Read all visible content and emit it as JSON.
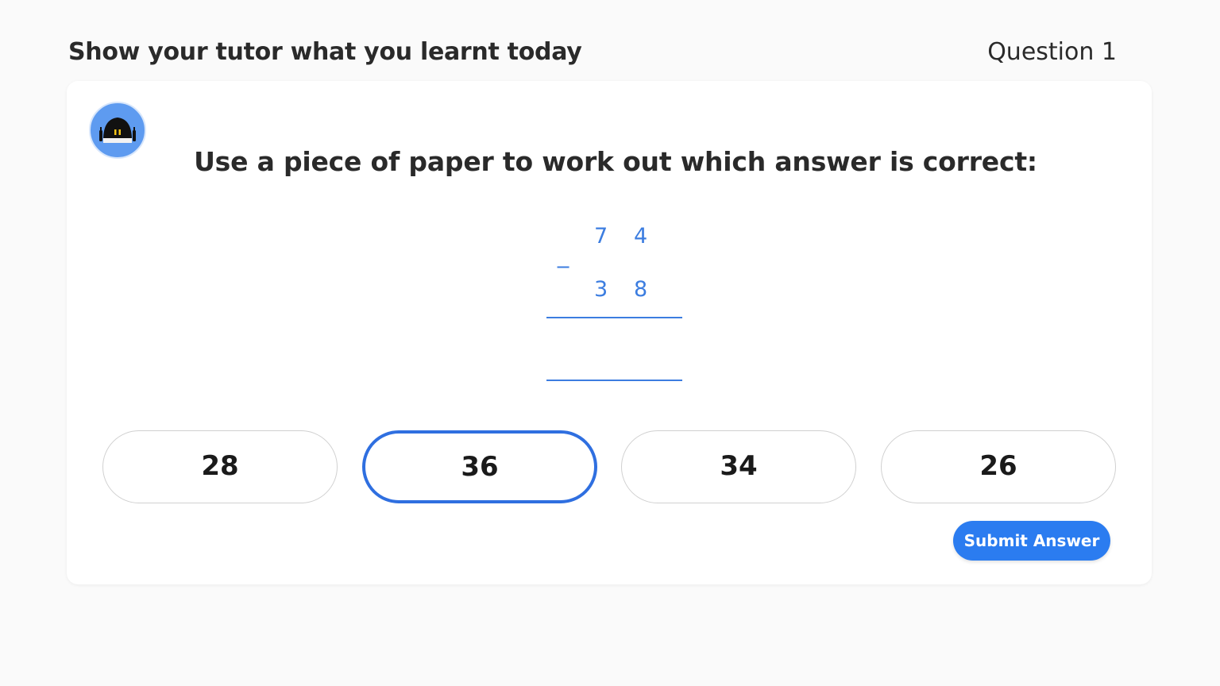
{
  "header": {
    "title": "Show your tutor what you learnt today",
    "question_label": "Question 1"
  },
  "card": {
    "avatar_icon": "robot-icon",
    "prompt": "Use a piece of paper to work out which answer is correct:",
    "problem": {
      "operator": "−",
      "top_tens": "7",
      "top_ones": "4",
      "bottom_tens": "3",
      "bottom_ones": "8"
    },
    "options": [
      {
        "label": "28",
        "selected": false
      },
      {
        "label": "36",
        "selected": true
      },
      {
        "label": "34",
        "selected": false
      },
      {
        "label": "26",
        "selected": false
      }
    ],
    "submit_label": "Submit Answer"
  },
  "colors": {
    "accent": "#2b7cf0",
    "selected_border": "#2f6fe0",
    "problem_text": "#3c7de0",
    "avatar_bg": "#5e9bf0"
  }
}
